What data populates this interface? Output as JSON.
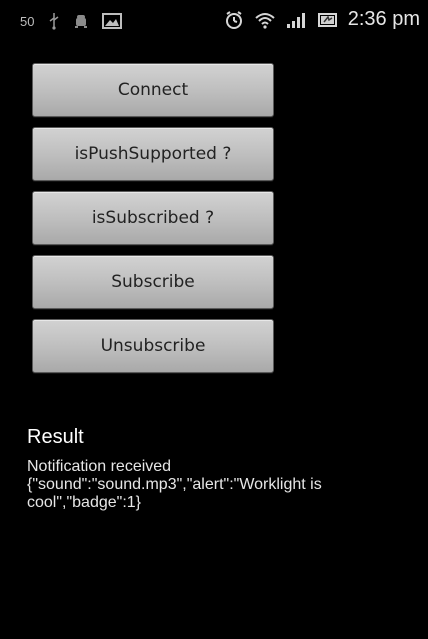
{
  "status_bar": {
    "left_number": "50",
    "icons_left": [
      "usb-icon",
      "android-icon",
      "image-icon"
    ],
    "icons_right": [
      "alarm-clock-icon",
      "wifi-icon",
      "signal-icon",
      "battery-icon"
    ],
    "time": "2:36 pm"
  },
  "buttons": [
    {
      "label": "Connect"
    },
    {
      "label": "isPushSupported ?"
    },
    {
      "label": "isSubscribed ?"
    },
    {
      "label": "Subscribe"
    },
    {
      "label": "Unsubscribe"
    }
  ],
  "result": {
    "title": "Result",
    "lines": [
      "Notification received",
      "{\"sound\":\"sound.mp3\",\"alert\":\"Worklight is",
      "cool\",\"badge\":1}"
    ]
  }
}
